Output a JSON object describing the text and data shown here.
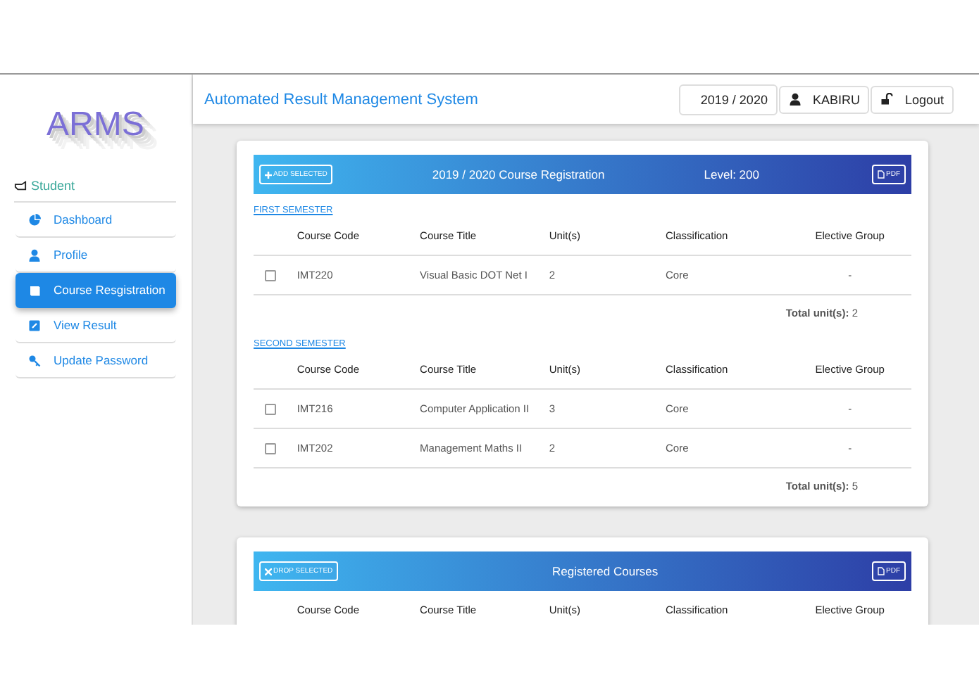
{
  "sidebar": {
    "logo": "ARMS",
    "role": "Student",
    "items": [
      {
        "label": "Dashboard",
        "selected": false
      },
      {
        "label": "Profile",
        "selected": false
      },
      {
        "label": "Course Resgistration",
        "selected": true
      },
      {
        "label": "View Result",
        "selected": false
      },
      {
        "label": "Update Password",
        "selected": false
      }
    ]
  },
  "header": {
    "title": "Automated Result Management System",
    "session": "2019 / 2020",
    "user": "KABIRU",
    "logout": "Logout"
  },
  "registration": {
    "action": "ADD SELECTED",
    "title": "2019 / 2020 Course Registration",
    "level_label": "Level: 200",
    "pdf": "PDF",
    "semesters": [
      {
        "name": "FIRST SEMESTER",
        "columns": [
          "Course Code",
          "Course Title",
          "Unit(s)",
          "Classification",
          "Elective Group"
        ],
        "rows": [
          {
            "checked": false,
            "cells": [
              "IMT220",
              "Visual Basic DOT Net I",
              "2",
              "Core",
              "-"
            ]
          }
        ],
        "total_label": "Total unit(s):",
        "total": "2"
      },
      {
        "name": "SECOND SEMESTER",
        "columns": [
          "Course Code",
          "Course Title",
          "Unit(s)",
          "Classification",
          "Elective Group"
        ],
        "rows": [
          {
            "checked": false,
            "cells": [
              "IMT216",
              "Computer Application II",
              "3",
              "Core",
              "-"
            ]
          },
          {
            "checked": false,
            "cells": [
              "IMT202",
              "Management Maths II",
              "2",
              "Core",
              "-"
            ]
          }
        ],
        "total_label": "Total unit(s):",
        "total": "5"
      }
    ]
  },
  "registered": {
    "action": "DROP SELECTED",
    "title": "Registered Courses",
    "pdf": "PDF",
    "columns": [
      "Course Code",
      "Course Title",
      "Unit(s)",
      "Classification",
      "Elective Group"
    ]
  }
}
